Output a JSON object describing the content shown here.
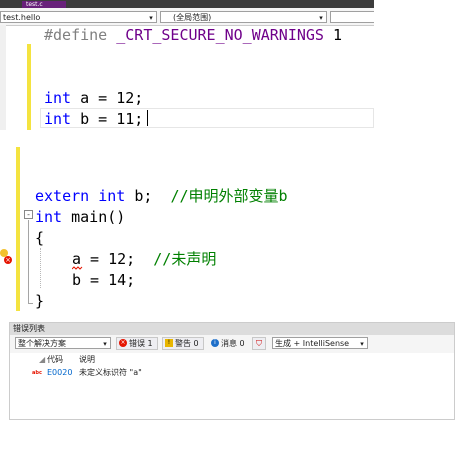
{
  "top_pane": {
    "tab_label": "test.c",
    "project_combo": "test.hello",
    "scope_combo": "(全局范围)",
    "lines": {
      "define_directive": "#define",
      "define_macro": "_CRT_SECURE_NO_WARNINGS",
      "define_value": "1",
      "line_a_kw": "int",
      "line_a_rest": " a = 12;",
      "line_b_kw": "int",
      "line_b_rest": " b = 11;"
    }
  },
  "bottom_pane": {
    "extern_kw": "extern",
    "extern_int": "int",
    "extern_rest": " b;  ",
    "extern_comment": "//申明外部变量b",
    "main_int": "int",
    "main_rest": " main()",
    "collapse_symbol": "-",
    "brace_open": "{",
    "assign_a_var": "a",
    "assign_a_rest": " = 12;  ",
    "assign_a_comment": "//未声明",
    "assign_b": "b = 14;",
    "brace_close": "}"
  },
  "error_list": {
    "title": "错误列表",
    "scope_select": "整个解决方案",
    "errors_label": "错误 1",
    "warnings_label": "警告 0",
    "messages_label": "消息 0",
    "filter_label": "生成 + IntelliSense",
    "columns": {
      "code": "代码",
      "description": "说明"
    },
    "rows": [
      {
        "code": "E0020",
        "description": "未定义标识符 \"a\""
      }
    ]
  },
  "colors": {
    "keyword": "#0000ff",
    "macro": "#6f008a",
    "comment": "#008000",
    "change_bar": "#f4e33f",
    "error": "#e51400"
  }
}
